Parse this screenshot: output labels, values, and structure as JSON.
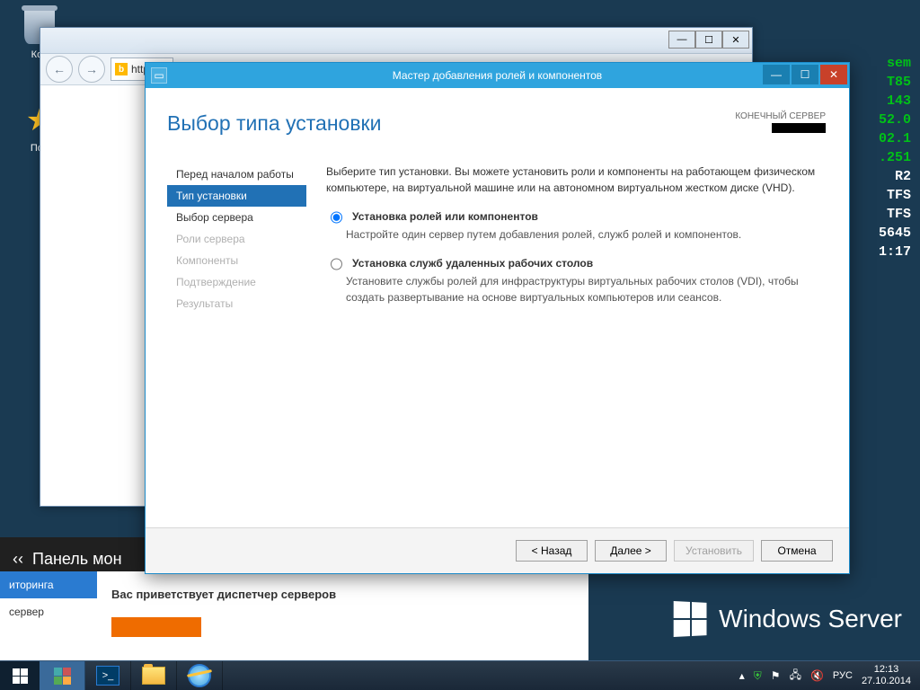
{
  "desktop": {
    "recycle_bin": "Кор",
    "favorites": "Пол"
  },
  "bginfo": {
    "lines": [
      "sem",
      "T85",
      "143",
      "52.0",
      "02.1",
      ".251",
      "R2",
      "TFS",
      "TFS",
      "5645",
      "1:17"
    ],
    "white_idx": [
      6,
      7,
      8,
      9,
      10
    ]
  },
  "windows_brand": "Windows Server",
  "ie": {
    "url_prefix": "http",
    "back": "←",
    "fwd": "→",
    "win_min": "—",
    "win_max": "☐",
    "win_close": "✕"
  },
  "dashboard": {
    "title_prefix": "‹‹",
    "title": "Панель мон",
    "welcome": "Вас приветствует диспетчер серверов",
    "sidebar": {
      "monitoring": "иторинга",
      "server": "сервер"
    }
  },
  "wizard": {
    "title": "Мастер добавления ролей и компонентов",
    "heading": "Выбор типа установки",
    "dest_label": "КОНЕЧНЫЙ СЕРВЕР",
    "win_min": "—",
    "win_max": "☐",
    "win_close": "✕",
    "steps": [
      {
        "label": "Перед началом работы",
        "state": "done"
      },
      {
        "label": "Тип установки",
        "state": "sel"
      },
      {
        "label": "Выбор сервера",
        "state": "next"
      },
      {
        "label": "Роли сервера",
        "state": "dis"
      },
      {
        "label": "Компоненты",
        "state": "dis"
      },
      {
        "label": "Подтверждение",
        "state": "dis"
      },
      {
        "label": "Результаты",
        "state": "dis"
      }
    ],
    "intro": "Выберите тип установки. Вы можете установить роли и компоненты на работающем физическом компьютере, на виртуальной машине или на автономном виртуальном жестком диске (VHD).",
    "options": [
      {
        "title": "Установка ролей или компонентов",
        "desc": "Настройте один сервер путем добавления ролей, служб ролей и компонентов.",
        "checked": true
      },
      {
        "title": "Установка служб удаленных рабочих столов",
        "desc": "Установите службы ролей для инфраструктуры виртуальных рабочих столов (VDI), чтобы создать развертывание на основе виртуальных компьютеров или сеансов.",
        "checked": false
      }
    ],
    "buttons": {
      "back": "< Назад",
      "next": "Далее >",
      "install": "Установить",
      "cancel": "Отмена"
    }
  },
  "taskbar": {
    "lang": "РУС",
    "time": "12:13",
    "date": "27.10.2014"
  }
}
